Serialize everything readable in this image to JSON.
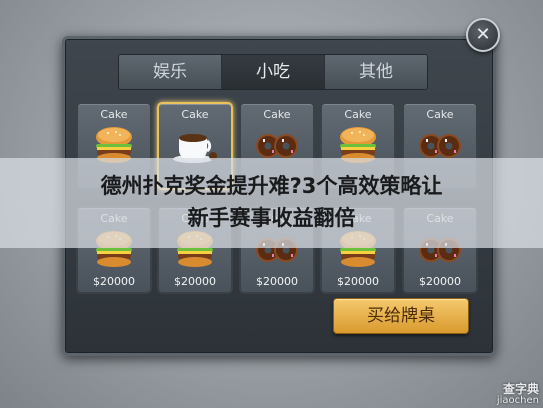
{
  "store": {
    "tabs": [
      {
        "label": "娱乐"
      },
      {
        "label": "小吃"
      },
      {
        "label": "其他"
      }
    ],
    "active_tab": 1,
    "items": [
      {
        "name": "Cake",
        "price": "",
        "icon": "burger-icon"
      },
      {
        "name": "Cake",
        "price": "",
        "icon": "coffee-icon"
      },
      {
        "name": "Cake",
        "price": "",
        "icon": "donut-icon"
      },
      {
        "name": "Cake",
        "price": "",
        "icon": "burger-icon"
      },
      {
        "name": "Cake",
        "price": "",
        "icon": "donut-icon"
      },
      {
        "name": "Cake",
        "price": "$20000",
        "icon": "burger-icon"
      },
      {
        "name": "Cake",
        "price": "$20000",
        "icon": "burger-icon"
      },
      {
        "name": "Cake",
        "price": "$20000",
        "icon": "donut-icon"
      },
      {
        "name": "Cake",
        "price": "$20000",
        "icon": "burger-icon"
      },
      {
        "name": "Cake",
        "price": "$20000",
        "icon": "donut-icon"
      }
    ],
    "selected_index": 1,
    "buy_button": "买给牌桌",
    "close_icon": "close-icon"
  },
  "banner": {
    "line1": "德州扑克奖金提升难?3个高效策略让",
    "line2": "新手赛事收益翻倍"
  },
  "watermark": {
    "line1": "查字典",
    "line2": "jiaochen"
  },
  "colors": {
    "accent_gold": "#e9c25a",
    "panel_bg": "#353c42",
    "button_orange": "#f0b84e"
  }
}
